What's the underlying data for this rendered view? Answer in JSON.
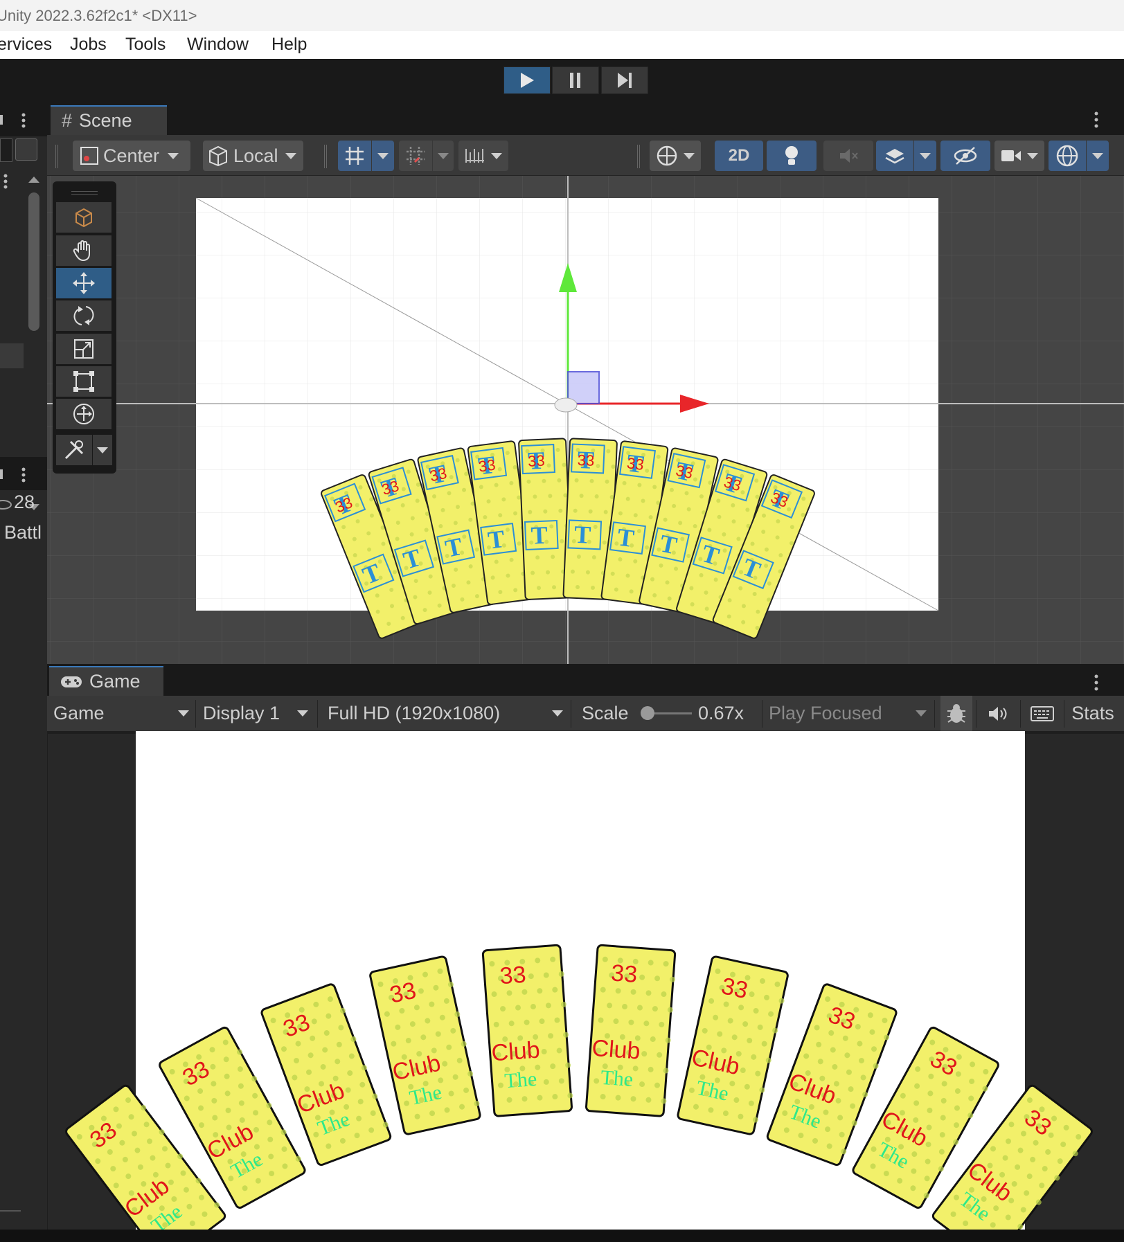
{
  "window": {
    "title": "Unity 2022.3.62f2c1* <DX11>"
  },
  "menu": [
    "ervices",
    "Jobs",
    "Tools",
    "Window",
    "Help"
  ],
  "playbar": {
    "play": "play-icon",
    "pause": "pause-icon",
    "step": "step-icon",
    "active_color": "#2f5d87"
  },
  "left_panel": {
    "count": "28",
    "label": "Battl"
  },
  "scene": {
    "tab_label": "Scene",
    "pivot_mode": "Center",
    "pivot_rotation": "Local",
    "mode_2d": "2D",
    "tools": [
      "view-cube-icon",
      "hand-icon",
      "move-icon",
      "rotate-icon",
      "scale-icon",
      "rect-icon",
      "transform-icon",
      "custom-tool-icon"
    ],
    "selected_tool": "move-icon"
  },
  "game": {
    "tab_label": "Game",
    "view_select": "Game",
    "display": "Display 1",
    "resolution": "Full HD (1920x1080)",
    "scale_label": "Scale",
    "scale_value": "0.67x",
    "play_mode": "Play Focused",
    "stats": "Stats"
  },
  "cards": {
    "game_value": "33",
    "game_text": "Club",
    "game_subtext": "The",
    "scene_letter": "T",
    "scene_value": "33",
    "card_count": 10,
    "face_color": "#f2f06a",
    "value_color": "#e0161a",
    "letter_color": "#2b8fd6"
  },
  "colors": {
    "accent": "#2f5d87",
    "panel": "#383838",
    "dark": "#191919",
    "gizmo_x": "#e8262a",
    "gizmo_y": "#5ee83a"
  }
}
